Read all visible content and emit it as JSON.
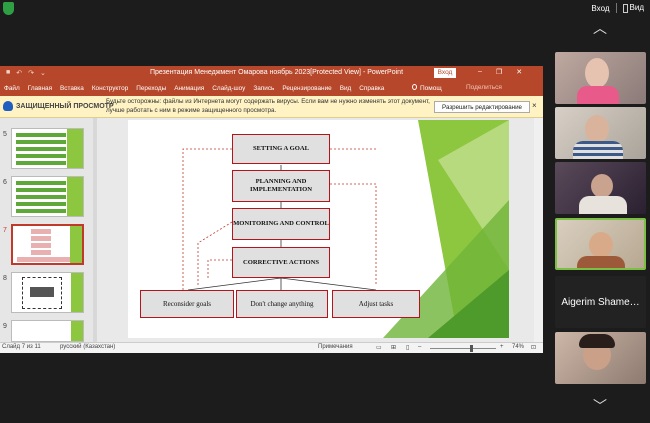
{
  "zoom": {
    "enter_label": "Вход",
    "view_label": "Вид"
  },
  "ppt": {
    "title": "Презентация Менеджмент Омарова ноябрь 2023[Protected View] - PowerPoint",
    "sign_in": "Вход",
    "tabs": [
      "Файл",
      "Главная",
      "Вставка",
      "Конструктор",
      "Переходы",
      "Анимация",
      "Слайд-шоу",
      "Запись",
      "Рецензирование",
      "Вид",
      "Справка"
    ],
    "tell_me": "Помощ",
    "share": "Поделиться",
    "protected_view": {
      "title": "ЗАЩИЩЕННЫЙ ПРОСМОТР",
      "message": "Будьте осторожны: файлы из Интернета могут содержать вирусы. Если вам не нужно изменять этот документ, лучше работать с ним в режиме защищенного просмотра.",
      "enable_button": "Разрешить редактирование",
      "close": "×"
    },
    "thumbnails": [
      {
        "num": "5"
      },
      {
        "num": "6"
      },
      {
        "num": "7"
      },
      {
        "num": "8"
      },
      {
        "num": "9"
      }
    ],
    "slide": {
      "boxes": {
        "goal": "SETTING A GOAL",
        "planning": "PLANNING AND IMPLEMENTATION",
        "monitoring": "MONITORING AND CONTROL",
        "corrective": "CORRECTIVE ACTIONS",
        "reconsider": "Reconsider goals",
        "dont_change": "Don't change anything",
        "adjust": "Adjust tasks"
      }
    },
    "status": {
      "slide_info": "Слайд 7 из 11",
      "language": "русский (Казахстан)",
      "notes": "Примечания",
      "zoom": "74%"
    },
    "colors": {
      "accent": "#b7472a",
      "box_border": "#b5141a",
      "box_fill": "#e0e0e0",
      "green": "#8dc63f"
    }
  },
  "participants": {
    "name_tile": "Aigerim Shame…"
  }
}
